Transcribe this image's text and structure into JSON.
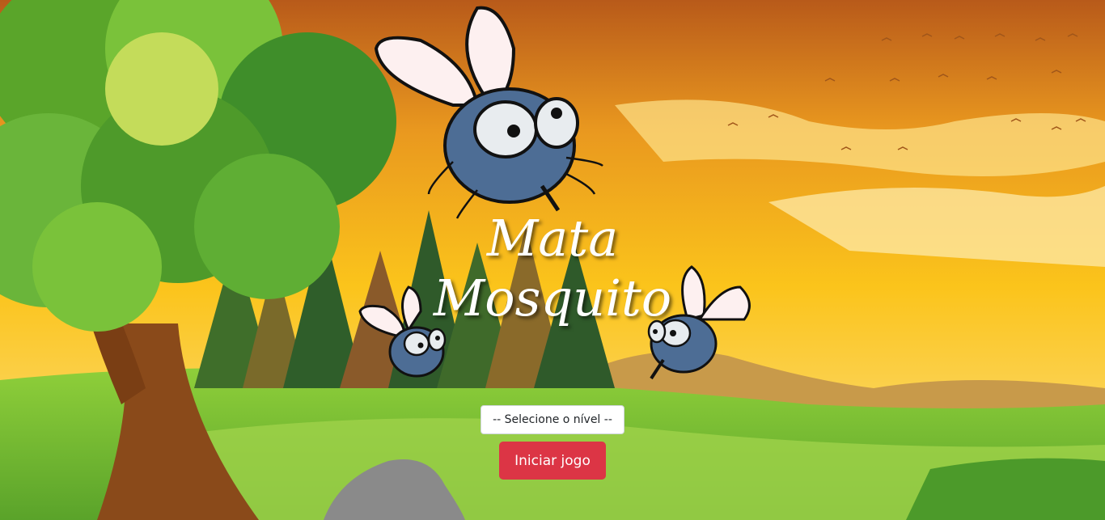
{
  "game": {
    "title_line1": "Mata",
    "title_line2": "Mosquito",
    "level_select": {
      "placeholder": "-- Selecione o nível --"
    },
    "start_button": "Iniciar jogo"
  },
  "colors": {
    "sky_top": "#c0581a",
    "sky_bottom": "#f9c51c",
    "grass": "#7cc12a",
    "button": "#dc3545",
    "mosquito_body": "#4d6d95"
  }
}
